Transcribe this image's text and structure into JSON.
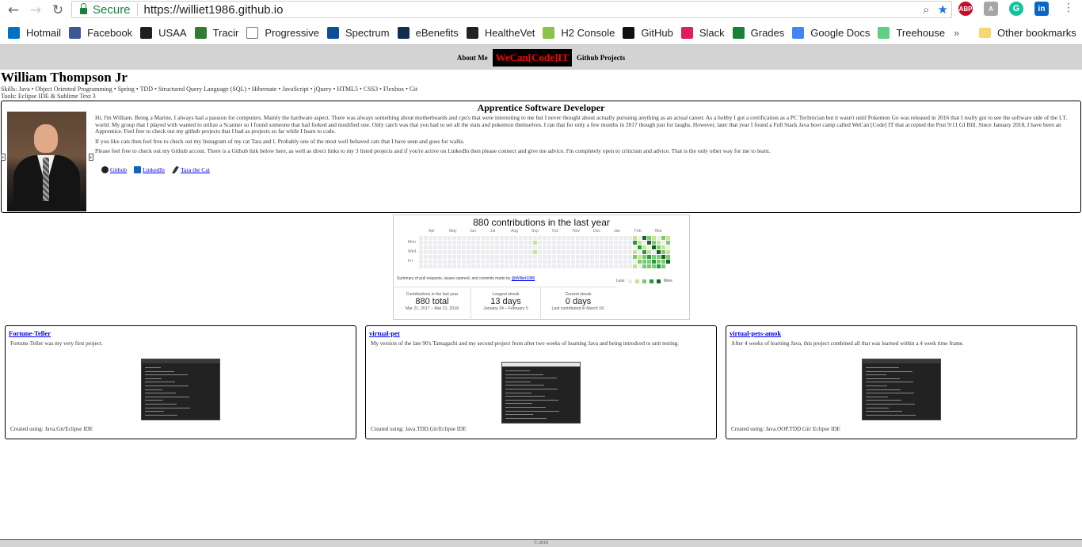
{
  "browser": {
    "secure_label": "Secure",
    "url": "https://williet1986.github.io",
    "bookmarks": [
      {
        "label": "Hotmail",
        "icon": "outlook-icon",
        "color": "#0072c6"
      },
      {
        "label": "Facebook",
        "icon": "facebook-icon",
        "color": "#3b5998"
      },
      {
        "label": "USAA",
        "icon": "usaa-icon",
        "color": "#1f1f1f"
      },
      {
        "label": "Tracir",
        "icon": "tracir-icon",
        "color": "#2e7d32"
      },
      {
        "label": "Progressive",
        "icon": "page-icon",
        "color": "#ffffff"
      },
      {
        "label": "Spectrum",
        "icon": "spectrum-icon",
        "color": "#0b4f9c"
      },
      {
        "label": "eBenefits",
        "icon": "ebenefits-icon",
        "color": "#112e51"
      },
      {
        "label": "HealtheVet",
        "icon": "healthevet-icon",
        "color": "#222222"
      },
      {
        "label": "H2 Console",
        "icon": "h2-icon",
        "color": "#8bc34a"
      },
      {
        "label": "GitHub",
        "icon": "github-icon",
        "color": "#111111"
      },
      {
        "label": "Slack",
        "icon": "slack-icon",
        "color": "#e01e5a"
      },
      {
        "label": "Grades",
        "icon": "sheets-icon",
        "color": "#188038"
      },
      {
        "label": "Google Docs",
        "icon": "docs-icon",
        "color": "#4285f4"
      },
      {
        "label": "Treehouse",
        "icon": "treehouse-icon",
        "color": "#5fcf80"
      }
    ],
    "more_label": "»",
    "other_bookmarks": "Other bookmarks",
    "extensions": [
      "ABP",
      "A",
      "G",
      "in"
    ]
  },
  "nav": {
    "about_label": "About Me",
    "logo_text": "WeCan[Code]IT",
    "projects_label": "Github Projects"
  },
  "header": {
    "name": "William Thompson Jr",
    "skills": "Skills: Java • Object Oriented Programming • Spring • TDD • Structured Query Language (SQL) • Hibernate • JavaScript • jQuery • HTML5 • CSS3 • Flexbox • Git",
    "tools": "Tools: Eclipse IDE & Sublime Text 3"
  },
  "about": {
    "title": "Apprentice Software Developer",
    "paragraphs": [
      "Hi, I'm William. Being a Marine, I always had a passion for computers. Mainly the hardware aspect. There was always something about motherboards and cpu's that were interesting to me but I never thought about actually pursuing anything as an actual career. As a hobby I got a certification as a PC Technician but it wasn't until Pokemon Go was released in 2016 that I really got to see the software side of the I.T. world. My group that I played with wanted to utilize a Scanner so I found someone that had forked and modified one. Only catch was that you had to set all the stats and pokemon themselves. I ran that for only a few months in 2017 though just for laughs. However, later that year I found a Full Stack Java boot camp called WeCan [Code] IT that accepted the Post 9/11 GI Bill. Since January 2018, I have been an Apprentice. Feel free to check out my github projects that I had as projects so far while I learn to code.",
      "If you like cats then feel free to check out my Instagram of my cat Tara and I. Probably one of the most well behaved cats that I have seen and goes for walks.",
      "Please feel free to check out my Github accout. There is a Github link below here, as well as direct links to my 3 listed projects and if you're active on LinkedIn then please connect and give me advice. I'm completely open to criticism and advice. That is the only other way for me to learn."
    ],
    "links": [
      {
        "label": "Github",
        "icon": "github-icon"
      },
      {
        "label": "LinkedIn",
        "icon": "linkedin-icon"
      },
      {
        "label": "Tara the Cat",
        "icon": "cat-icon"
      }
    ],
    "arrow_left": "‹",
    "arrow_right": "›"
  },
  "contributions": {
    "title": "880 contributions in the last year",
    "months": [
      "Apr",
      "May",
      "Jun",
      "Jul",
      "Aug",
      "Sep",
      "Oct",
      "Nov",
      "Dec",
      "Jan",
      "Feb",
      "Mar"
    ],
    "days": [
      "Mon",
      "Wed",
      "Fri"
    ],
    "summary_prefix": "Summary of pull requests, issues opened, and commits made by ",
    "summary_user": "@Williet1986",
    "legend_less": "Less",
    "legend_more": "More",
    "colors": [
      "#ebedf0",
      "#c6e48b",
      "#7bc96f",
      "#239a3b",
      "#196127"
    ],
    "stats": [
      {
        "label": "Contributions in the last year",
        "value": "880 total",
        "sub": "Mar 21, 2017 – Mar 21, 2018"
      },
      {
        "label": "Longest streak",
        "value": "13 days",
        "sub": "January 24 – February 5"
      },
      {
        "label": "Current streak",
        "value": "0 days",
        "sub": "Last contributed in March 18."
      }
    ]
  },
  "projects": [
    {
      "title": "Fortune-Teller",
      "desc": "Fortune-Teller was my very first project.",
      "footer": "Created using: Java.Git/Eclipse IDE"
    },
    {
      "title": "virtual-pet",
      "desc": "My version of the late 90's Tamagachi and my second project from after two weeks of learning Java and being introdced to unit testing.",
      "footer": "Created using: Java.TDD.Git/Eclipse IDE"
    },
    {
      "title": "virtual-pets-amok",
      "desc": "After 4 weeks of learning Java, this project combined all that was learned within a 4 week time frame.",
      "footer": "Created using: Java.OOP.TDD.Git/ Eclipse IDE"
    }
  ],
  "footer": {
    "text": "© 2018"
  }
}
